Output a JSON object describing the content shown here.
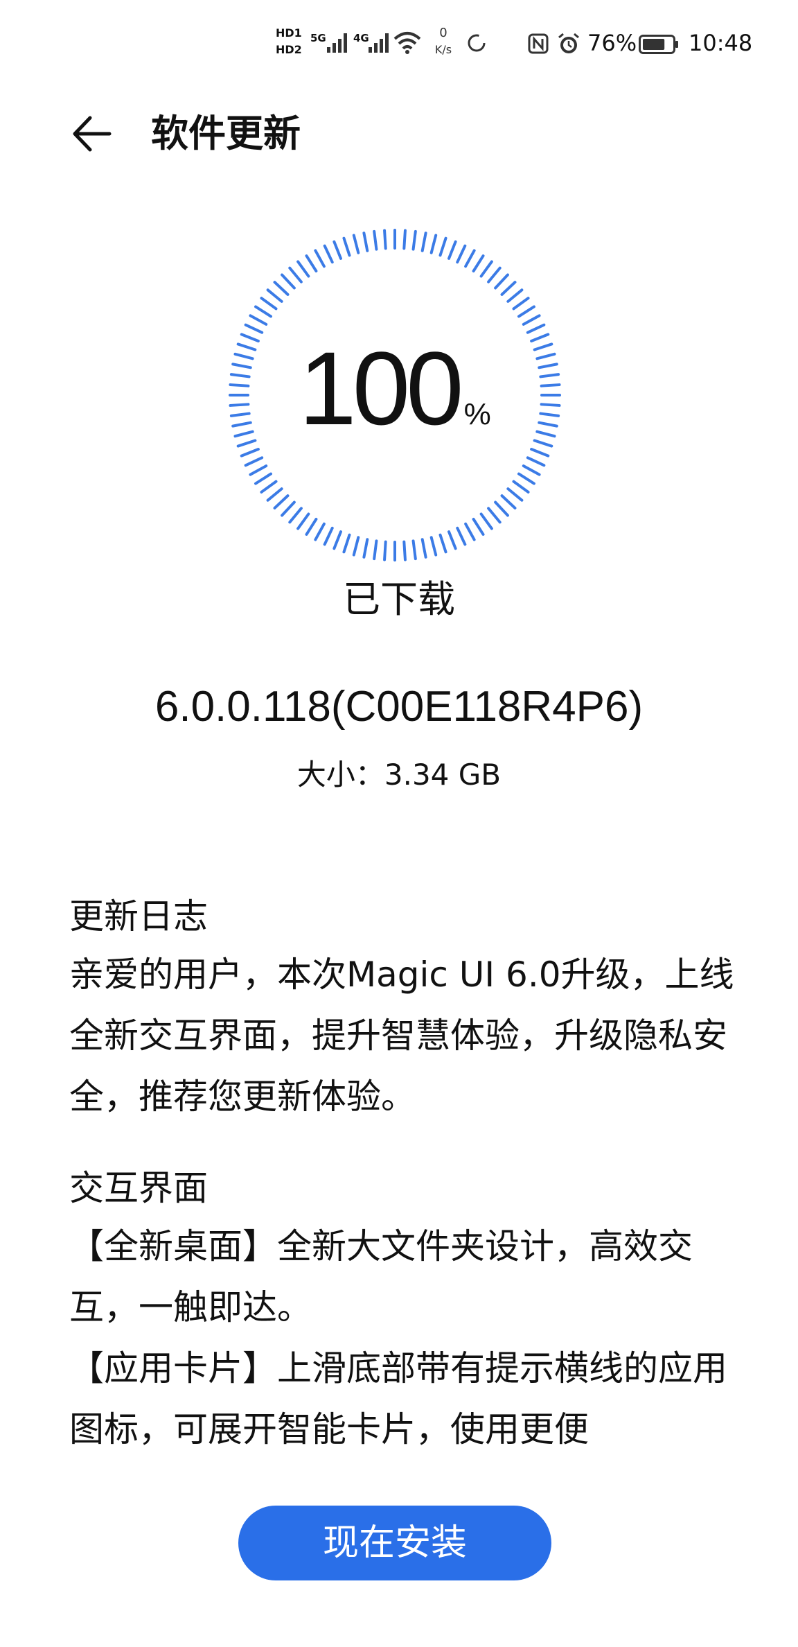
{
  "status_bar": {
    "hd1": "HD1",
    "hd2": "HD2",
    "net1": "5G",
    "net2": "4G",
    "speed_value": "0",
    "speed_unit": "K/s",
    "battery_percent": "76%",
    "battery_level": 0.76,
    "time": "10:48",
    "icons": [
      "signal-icon",
      "wifi-icon",
      "sync-ring-icon",
      "nfc-icon",
      "alarm-icon",
      "battery-icon"
    ]
  },
  "header": {
    "back_icon": "arrow-left-icon",
    "title": "软件更新"
  },
  "progress": {
    "value": "100",
    "unit": "%",
    "fraction": 1.0,
    "status": "已下载",
    "accent_color": "#3b7be6"
  },
  "package": {
    "version": "6.0.0.118(C00E118R4P6)",
    "size": "大小：3.34 GB"
  },
  "changelog": {
    "heading": "更新日志",
    "intro": "亲爱的用户，本次Magic UI 6.0升级，上线全新交互界面，提升智慧体验，升级隐私安全，推荐您更新体验。",
    "section_title": "交互界面",
    "item1": "【全新桌面】全新大文件夹设计，高效交互，一触即达。",
    "item2": "【应用卡片】上滑底部带有提示横线的应用图标，可展开智能卡片，使用更便"
  },
  "actions": {
    "install_label": "现在安装",
    "install_color": "#2a6fe8"
  }
}
